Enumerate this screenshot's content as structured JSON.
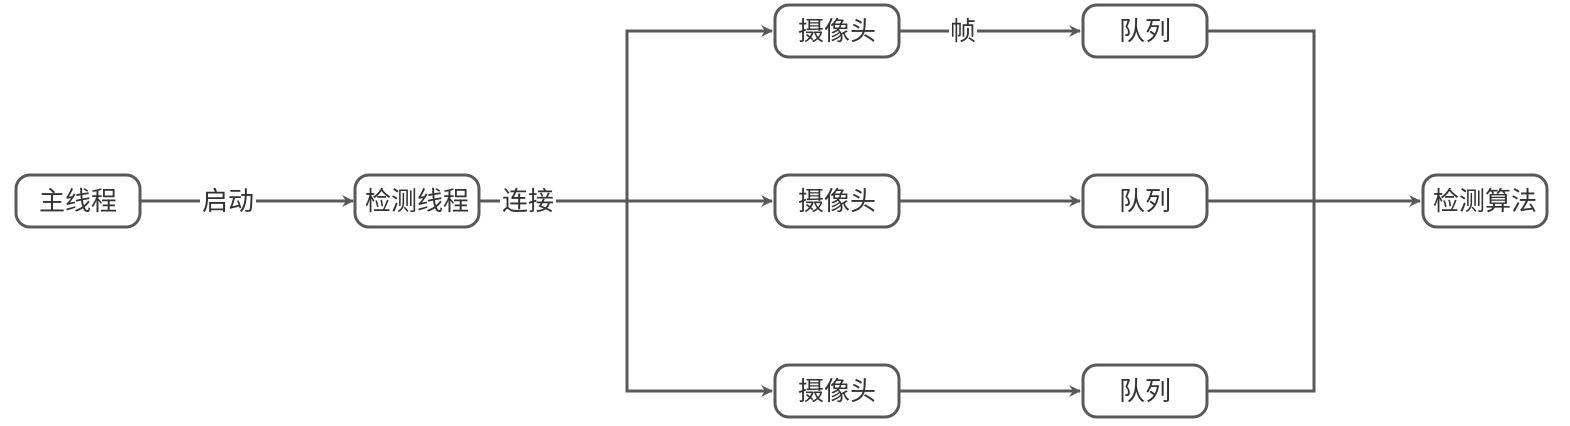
{
  "nodes": {
    "main_thread": "主线程",
    "detect_thread": "检测线程",
    "camera_1": "摄像头",
    "camera_2": "摄像头",
    "camera_3": "摄像头",
    "queue_1": "队列",
    "queue_2": "队列",
    "queue_3": "队列",
    "detect_algorithm": "检测算法"
  },
  "edges": {
    "start_label": "启动",
    "connect_label": "连接",
    "frame_label": "帧"
  },
  "colors": {
    "stroke": "#595959",
    "text": "#333333",
    "background": "#ffffff"
  }
}
